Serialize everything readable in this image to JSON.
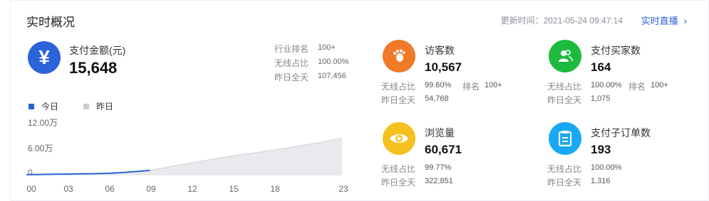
{
  "header": {
    "title": "实时概况",
    "update_time": "更新时间：2021-05-24 09:47:14",
    "live_link": "实时直播"
  },
  "main_metric": {
    "icon": "yen-icon",
    "label": "支付金额(元)",
    "value": "15,648",
    "rank_label": "行业排名",
    "rank_value": "100+",
    "wireless_label": "无线占比",
    "wireless_value": "100.00%",
    "yesterday_label": "昨日全天",
    "yesterday_value": "107,456"
  },
  "legend": {
    "today": "今日",
    "yesterday": "昨日"
  },
  "colors": {
    "today": "#2b63d9",
    "yesterday_fill": "#e9eaed",
    "yesterday_line": "#d6d8dc"
  },
  "chart_data": {
    "type": "area",
    "x_ticks": [
      "00",
      "03",
      "06",
      "09",
      "12",
      "15",
      "18",
      "23"
    ],
    "y_ticks": [
      "12.00万",
      "6.00万",
      "0"
    ],
    "ylim": [
      0,
      12
    ],
    "series": [
      {
        "name": "今日",
        "x": [
          0,
          1,
          2,
          3,
          4,
          5,
          6,
          7,
          8,
          9
        ],
        "values": [
          0.2,
          0.25,
          0.3,
          0.35,
          0.4,
          0.45,
          0.55,
          0.75,
          1.0,
          1.3
        ]
      },
      {
        "name": "昨日",
        "x": [
          0,
          3,
          6,
          9,
          12,
          15,
          18,
          21,
          23
        ],
        "values": [
          0.2,
          0.35,
          0.5,
          1.3,
          3.2,
          5.0,
          6.5,
          8.2,
          9.5
        ]
      }
    ]
  },
  "metrics": [
    {
      "id": "visitors",
      "icon": "footprint-icon",
      "color": "#f07a28",
      "label": "访客数",
      "value": "10,567",
      "wireless_label": "无线占比",
      "wireless_value": "99.60%",
      "rank_label": "排名",
      "rank_value": "100+",
      "yesterday_label": "昨日全天",
      "yesterday_value": "54,768"
    },
    {
      "id": "buyers",
      "icon": "user-group-icon",
      "color": "#1dbb3d",
      "label": "支付买家数",
      "value": "164",
      "wireless_label": "无线占比",
      "wireless_value": "100.00%",
      "rank_label": "排名",
      "rank_value": "100+",
      "yesterday_label": "昨日全天",
      "yesterday_value": "1,075"
    },
    {
      "id": "pageviews",
      "icon": "eye-icon",
      "color": "#f4c11e",
      "label": "浏览量",
      "value": "60,671",
      "wireless_label": "无线占比",
      "wireless_value": "99.77%",
      "yesterday_label": "昨日全天",
      "yesterday_value": "322,851"
    },
    {
      "id": "orders",
      "icon": "clipboard-icon",
      "color": "#18a8f2",
      "label": "支付子订单数",
      "value": "193",
      "wireless_label": "无线占比",
      "wireless_value": "100.00%",
      "yesterday_label": "昨日全天",
      "yesterday_value": "1,316"
    }
  ]
}
